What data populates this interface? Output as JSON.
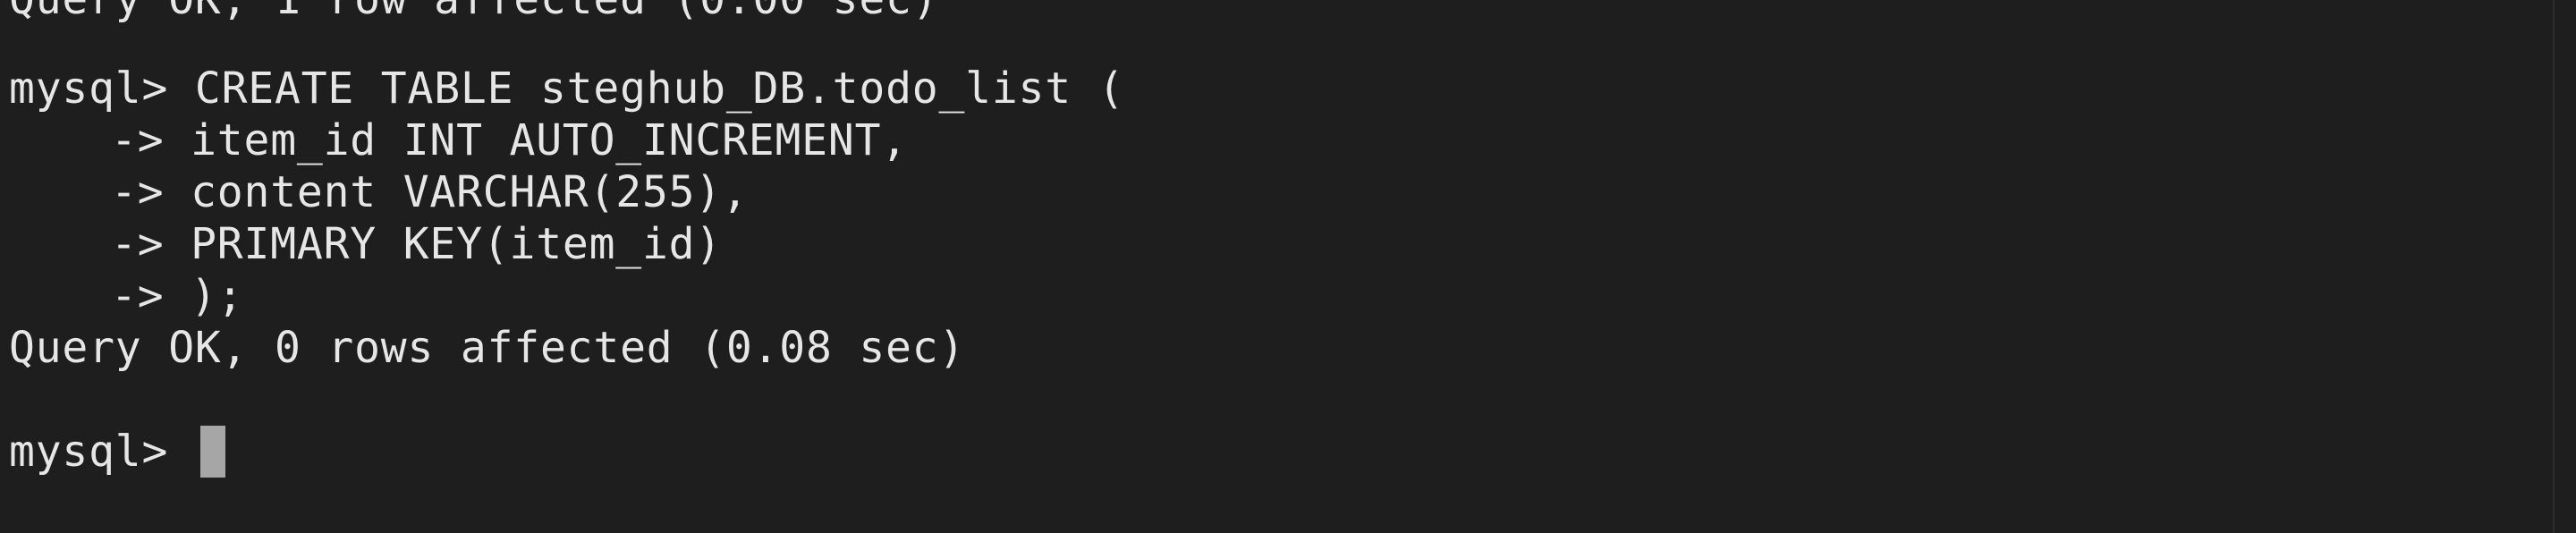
{
  "terminal": {
    "top_partial_line": "Query OK, 1 row affected (0.00 sec)",
    "prompt": "mysql>",
    "continuation_prompt": "->",
    "lines": [
      {
        "prompt": "mysql>",
        "text": "CREATE TABLE steghub_DB.todo_list ("
      },
      {
        "prompt": "->",
        "text": "item_id INT AUTO_INCREMENT,"
      },
      {
        "prompt": "->",
        "text": "content VARCHAR(255),"
      },
      {
        "prompt": "->",
        "text": "PRIMARY KEY(item_id)"
      },
      {
        "prompt": "->",
        "text": ");"
      }
    ],
    "result": "Query OK, 0 rows affected (0.08 sec)",
    "final_prompt": "mysql>"
  },
  "colors": {
    "background": "#1e1e1e",
    "foreground": "#e6e6e6",
    "cursor": "#a6a6a6"
  }
}
